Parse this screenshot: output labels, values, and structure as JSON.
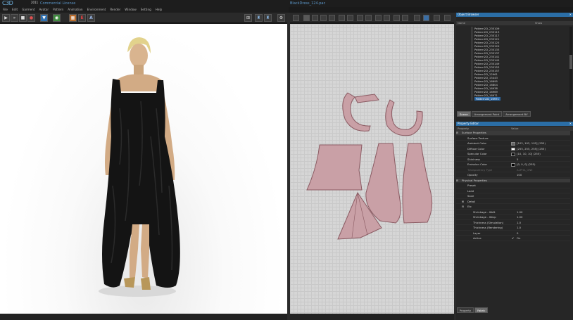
{
  "app": {
    "logo": "C3D",
    "logo_year": "2011",
    "license": "Commercial License",
    "document_title": "BlackDress_124.pac"
  },
  "menu": [
    "File",
    "Edit",
    "Garment",
    "Avatar",
    "Pattern",
    "Animation",
    "Environment",
    "Render",
    "Window",
    "Setting",
    "Help"
  ],
  "toolbar_left": {
    "icons": [
      "play-icon",
      "fast-forward-icon",
      "stop-icon",
      "record-icon",
      "shirt-icon",
      "globe-icon",
      "texture-icon",
      "edit-E-icon",
      "text-A-icon"
    ],
    "labels": {
      "edit": "E",
      "text": "A"
    }
  },
  "toolbar_right_icons": [
    "avatar-view-icon",
    "front-back-icon",
    "side-view-icon",
    "settings-icon"
  ],
  "object_browser": {
    "title": "Object Browser",
    "columns": [
      "Name",
      "Show"
    ],
    "items": [
      "Pattern2D_235109",
      "Pattern2D_235113",
      "Pattern2D_235117",
      "Pattern2D_235121",
      "Pattern2D_235125",
      "Pattern2D_235129",
      "Pattern2D_235133",
      "Pattern2D_235137",
      "Pattern2D_235141",
      "Pattern2D_235145",
      "Pattern2D_235149",
      "Pattern2D_235153",
      "Pattern2D_235157",
      "Pattern2D_12961",
      "Pattern2D_15443",
      "Pattern2D_16695",
      "Pattern2D_16804",
      "Pattern2D_16938",
      "Pattern2D_16969",
      "Pattern2D_16971",
      "Pattern2D_16971"
    ],
    "selected_index": 20,
    "tabs": [
      "Scene",
      "Arrangement Point",
      "Arrangement BV"
    ],
    "active_tab": 0
  },
  "property_editor": {
    "title": "Property Editor",
    "columns": [
      "Property",
      "Value"
    ],
    "rows": [
      {
        "label": "Surface Properties",
        "value": "",
        "indent": 0,
        "expander": "-"
      },
      {
        "label": "Surface Texture",
        "value": "",
        "indent": 1
      },
      {
        "label": "Ambient Color",
        "value": "[102, 102, 102] (255)",
        "indent": 1,
        "swatch": "#666666"
      },
      {
        "label": "Diffuse Color",
        "value": "[255, 255, 255] (255)",
        "indent": 1,
        "swatch": "#ffffff"
      },
      {
        "label": "Specular Color",
        "value": "[10, 10, 10] (255)",
        "indent": 1,
        "swatch": "#0a0a0a"
      },
      {
        "label": "Shininess",
        "value": "5",
        "indent": 1
      },
      {
        "label": "Emission Color",
        "value": "[0, 0, 0] (255)",
        "indent": 1,
        "swatch": "#000000"
      },
      {
        "label": "Transparency Type",
        "value": "ALPHA_ONE",
        "indent": 1,
        "dim": true
      },
      {
        "label": "Opacity",
        "value": "100",
        "indent": 1
      },
      {
        "label": "Physical Properties",
        "value": "",
        "indent": 0,
        "expander": "-"
      },
      {
        "label": "Preset",
        "value": "",
        "indent": 1
      },
      {
        "label": "Load",
        "value": "",
        "indent": 1
      },
      {
        "label": "Save",
        "value": "",
        "indent": 1
      },
      {
        "label": "Detail",
        "value": "",
        "indent": 1,
        "expander": "+"
      },
      {
        "label": "Etc",
        "value": "",
        "indent": 1,
        "expander": "-"
      },
      {
        "label": "Shrinkage - Weft",
        "value": "1.00",
        "indent": 2
      },
      {
        "label": "Shrinkage - Warp",
        "value": "1.00",
        "indent": 2
      },
      {
        "label": "Thickness (Simulation)",
        "value": "1.0",
        "indent": 2
      },
      {
        "label": "Thickness (Rendering)",
        "value": "1.0",
        "indent": 2
      },
      {
        "label": "Layer",
        "value": "0",
        "indent": 2
      },
      {
        "label": "Active",
        "value": "On",
        "indent": 2,
        "check": "✔"
      }
    ],
    "highlight_rows": [
      0,
      9
    ],
    "tabs": [
      "Property",
      "Fabric"
    ],
    "active_tab": 1
  },
  "colors": {
    "panel_header": "#2b6ea6",
    "pattern_fill": "#c9a0a6",
    "pattern_stroke": "#8a5a62",
    "dress": "#141414",
    "skin": "#d9b48f",
    "hair": "#e2d28c"
  }
}
